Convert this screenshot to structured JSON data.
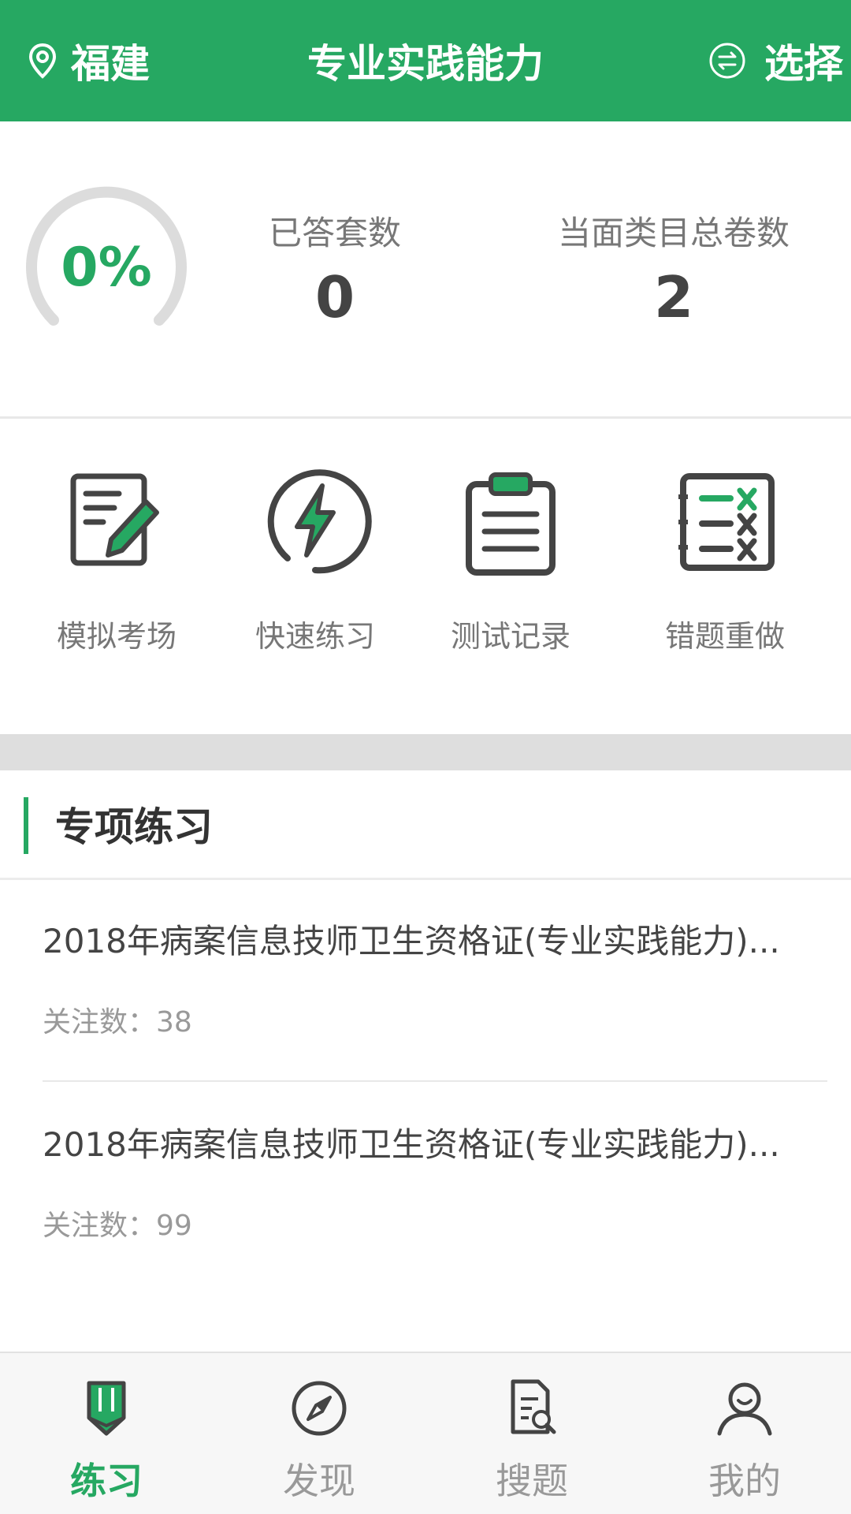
{
  "header": {
    "location": "福建",
    "title": "专业实践能力",
    "select_label": "选择",
    "bg_color": "#26a862"
  },
  "stats": {
    "progress_text": "0%",
    "progress_fraction": 0,
    "answered_label": "已答套数",
    "answered_value": "0",
    "total_label": "当面类目总卷数",
    "total_value": "2"
  },
  "functions": [
    {
      "label": "模拟考场",
      "icon": "exam-paper-pencil-icon"
    },
    {
      "label": "快速练习",
      "icon": "lightning-circle-icon"
    },
    {
      "label": "测试记录",
      "icon": "clipboard-icon"
    },
    {
      "label": "错题重做",
      "icon": "wrong-list-icon"
    }
  ],
  "section": {
    "title": "专项练习",
    "items": [
      {
        "title": "2018年病案信息技师卫生资格证(专业实践能力)...",
        "meta": "关注数：38"
      },
      {
        "title": "2018年病案信息技师卫生资格证(专业实践能力)...",
        "meta": "关注数：99"
      }
    ]
  },
  "tabs": [
    {
      "label": "练习",
      "icon": "pencil-book-icon",
      "active": true
    },
    {
      "label": "发现",
      "icon": "compass-icon",
      "active": false
    },
    {
      "label": "搜题",
      "icon": "document-search-icon",
      "active": false
    },
    {
      "label": "我的",
      "icon": "user-icon",
      "active": false
    }
  ],
  "colors": {
    "accent": "#26a862",
    "inactive": "#999999"
  }
}
